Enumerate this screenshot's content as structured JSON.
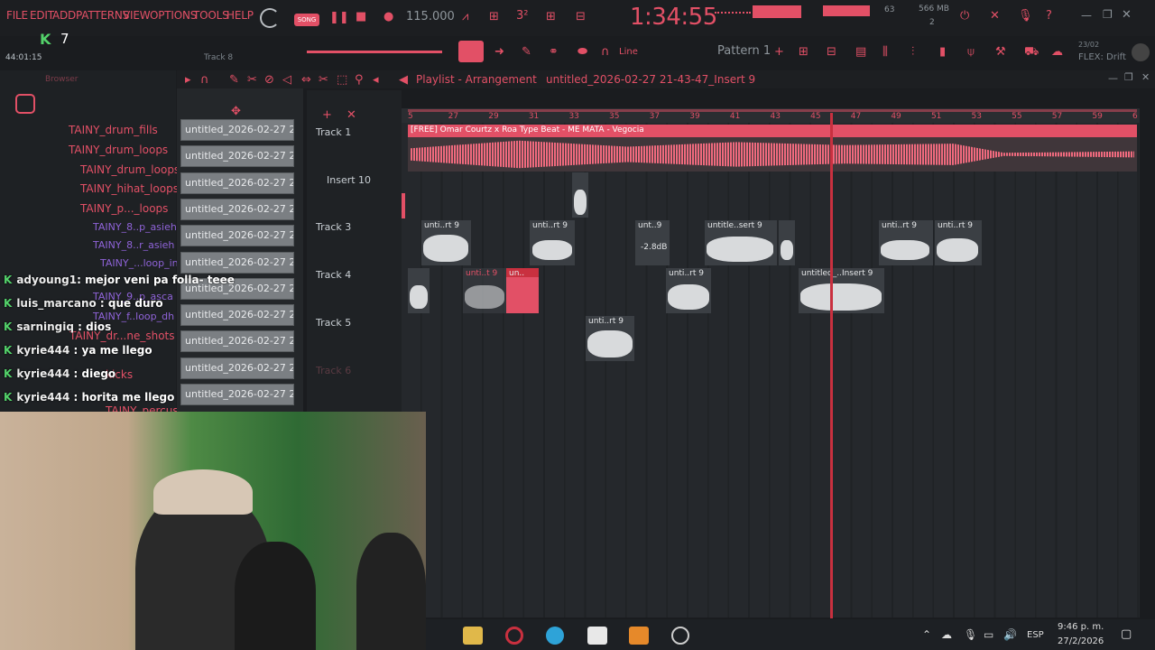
{
  "menu": [
    "FILE",
    "EDIT",
    "ADD",
    "PATTERNS",
    "VIEW",
    "OPTIONS",
    "TOOLS",
    "HELP"
  ],
  "toolbar": {
    "song_label": "SONG",
    "tempo": "115.000",
    "time_display": "1:34:55",
    "cpu_value": "63",
    "memory": "566 MB",
    "memory_sub": "2",
    "pattern": "Pattern 1",
    "snap": "Line",
    "flex_label": "FLEX: Drift",
    "flex_date": "23/02",
    "session_time": "44:01:15",
    "track_label": "Track 8",
    "kick_count": "7",
    "browser_label": "Browser"
  },
  "playlist": {
    "title": "Playlist - Arrangement",
    "breadcrumb": "untitled_2026-02-27 21-43-47_Insert 9"
  },
  "browser": {
    "items": [
      {
        "label": "TAINY_drum_fills",
        "sub": false
      },
      {
        "label": "TAINY_drum_loops",
        "sub": false
      },
      {
        "label": "TAINY_drum_loops",
        "sub": false
      },
      {
        "label": "TAINY_hihat_loops",
        "sub": false
      },
      {
        "label": "TAINY_p..._loops",
        "sub": false
      },
      {
        "label": "TAINY_8..p_asieh",
        "sub": true
      },
      {
        "label": "TAINY_8..r_asieh",
        "sub": true
      },
      {
        "label": "TAINY_...loop_in",
        "sub": true
      },
      {
        "label": "TAINY_9..p_asca",
        "sub": true
      },
      {
        "label": "TAINY_f..loop_dh",
        "sub": true
      },
      {
        "label": "TAINY_dr...ne_shots",
        "sub": false
      },
      {
        "label": "kicks",
        "sub": false
      },
      {
        "label": "TAINY_percussion",
        "sub": false
      }
    ]
  },
  "picker": {
    "items": [
      "untitled_2026-02-27 21-...",
      "untitled_2026-02-27 21-...",
      "untitled_2026-02-27 21-...",
      "untitled_2026-02-27 21-...",
      "untitled_2026-02-27 21-...",
      "untitled_2026-02-27 21-...",
      "untitled_2026-02-27 21-...",
      "untitled_2026-02-27 21-...",
      "untitled_2026-02-27 21-...",
      "untitled_2026-02-27 21-...",
      "untitled_2026-02-27 21-..."
    ]
  },
  "chat": [
    {
      "user": "adyoung1",
      "msg": ": mejor veni pa folla- teee"
    },
    {
      "user": "luis_marcano",
      "msg": " : que duro"
    },
    {
      "user": "sarningiq",
      "msg": " : dios"
    },
    {
      "user": "kyrie444",
      "msg": " : ya me llego"
    },
    {
      "user": "kyrie444",
      "msg": " : diego"
    },
    {
      "user": "kyrie444",
      "msg": " : horita me llego"
    }
  ],
  "tracks": [
    "Track 1",
    "Insert 10",
    "Track 3",
    "Track 4",
    "Track 5",
    "Track 6"
  ],
  "ruler": [
    "5",
    "27",
    "29",
    "31",
    "33",
    "35",
    "37",
    "39",
    "41",
    "43",
    "45",
    "47",
    "49",
    "51",
    "53",
    "55",
    "57",
    "59",
    "6"
  ],
  "clips": {
    "main": "[FREE] Omar Courtz x Roa Type Beat - ME MATA - Vegocia",
    "t3a": "unti..rt 9",
    "t3b": "unti..rt 9",
    "t3c": "unt..9",
    "t3c_gain": "-2.8dB",
    "t3d": "untitle..sert 9",
    "t3f": "unti..rt 9",
    "t3g": "unti..rt 9",
    "t4b": "unti..t 9",
    "t4c": "un..",
    "t4d": "unti..rt 9",
    "t4e": "untitled_..Insert 9",
    "t5a": "unti..rt 9"
  },
  "taskbar": {
    "lang": "ESP",
    "time": "9:46 p. m.",
    "date": "27/2/2026"
  },
  "colors": {
    "accent": "#e25066",
    "bg": "#1a1c1f",
    "clip": "#3b3f44",
    "playhead": "#c9303f"
  }
}
